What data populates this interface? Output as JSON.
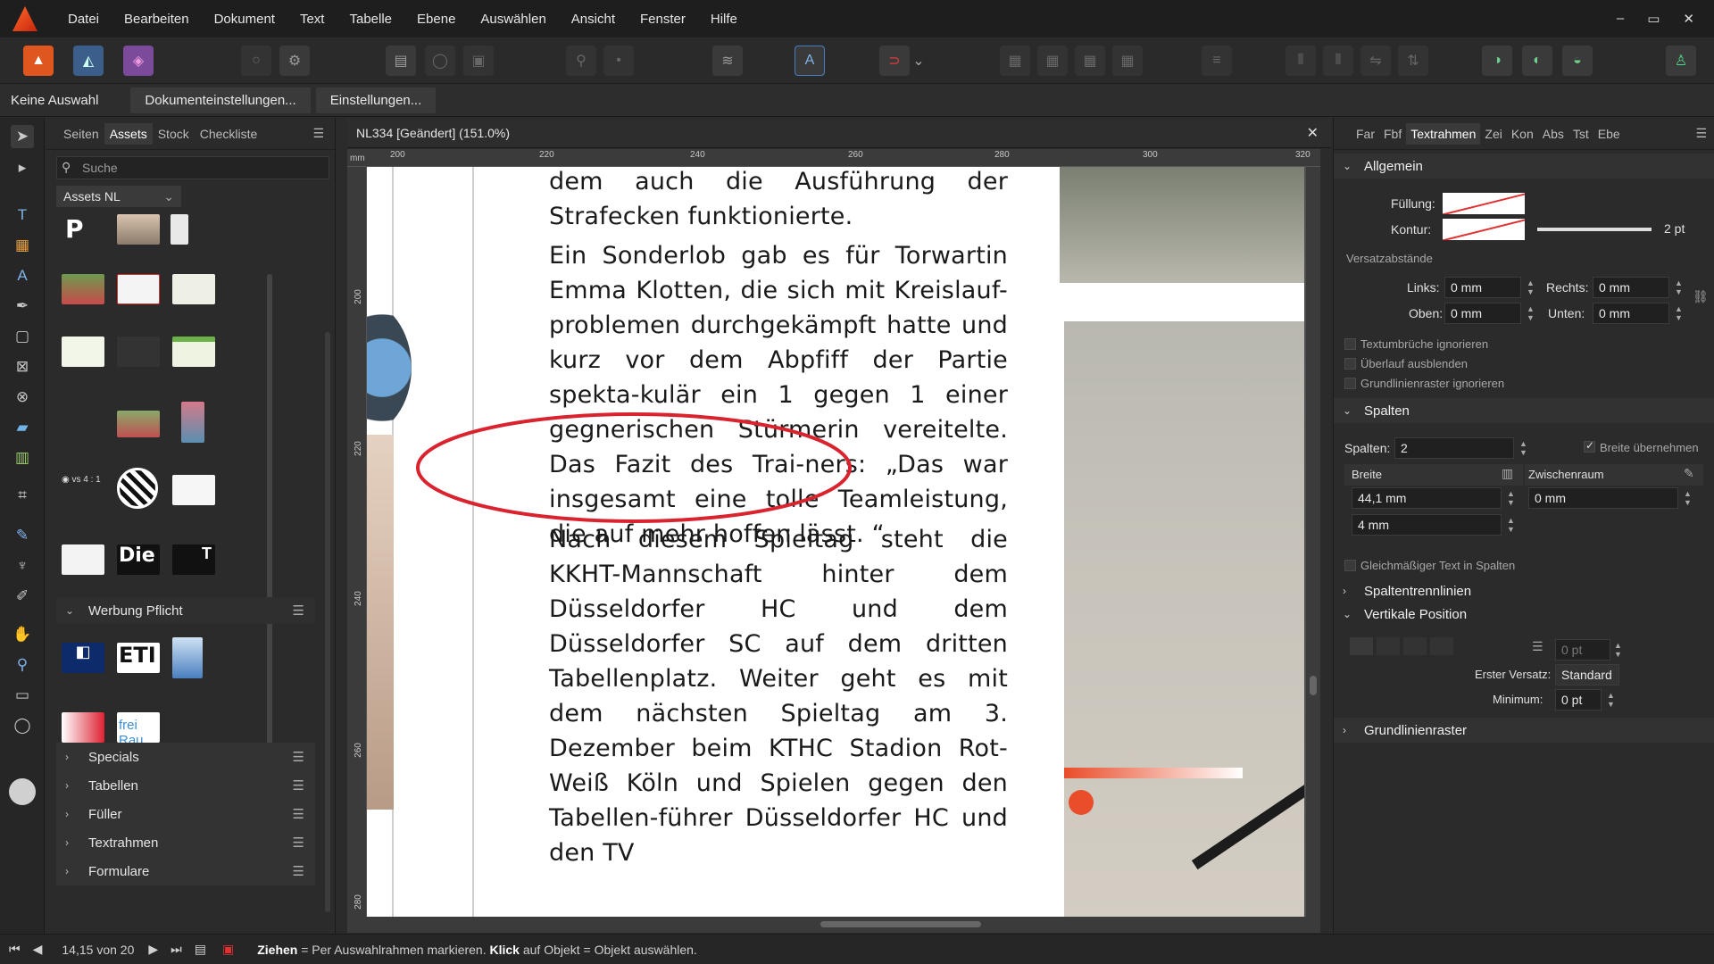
{
  "menu": [
    "Datei",
    "Bearbeiten",
    "Dokument",
    "Text",
    "Tabelle",
    "Ebene",
    "Auswählen",
    "Ansicht",
    "Fenster",
    "Hilfe"
  ],
  "window_buttons": [
    "–",
    "▭",
    "✕"
  ],
  "context": {
    "selection": "Keine Auswahl",
    "doc_settings": "Dokumenteinstellungen...",
    "settings": "Einstellungen..."
  },
  "left_panel": {
    "tabs": [
      "Seiten",
      "Assets",
      "Stock",
      "Checkliste"
    ],
    "active_tab": "Assets",
    "search_placeholder": "Suche",
    "asset_set": "Assets NL",
    "group_title": "Werbung Pflicht",
    "thumb_texts": {
      "die": "Die",
      "t": "T",
      "eti": "ETI",
      "frei": "frei Rau",
      "p": "P"
    },
    "categories": [
      "Specials",
      "Tabellen",
      "Füller",
      "Textrahmen",
      "Formulare"
    ]
  },
  "document": {
    "tab_title": "NL334 [Geändert] (151.0%)",
    "ruler_unit": "mm",
    "h_ruler": [
      "200",
      "220",
      "240",
      "260",
      "280",
      "300",
      "320"
    ],
    "v_ruler": [
      "200",
      "220",
      "240",
      "260",
      "280"
    ],
    "paragraphs": [
      "Kombinationsspiel attestierte, bei dem auch die Ausführung der Strafecken funktionierte.",
      "Ein Sonderlob gab es für Torwartin Emma Klotten, die sich mit Kreislauf-problemen durchgekämpft hatte und kurz vor dem Abpfiff der Partie spekta-kulär ein 1 gegen 1 einer gegnerischen Stürmerin vereitelte. Das Fazit des Trai-ners: „Das war insgesamt eine tolle Teamleistung, die auf mehr hoffen lässt. “",
      "Nach diesem Spieltag steht die KKHT-Mannschaft hinter dem Düsseldorfer HC und dem Düsseldorfer SC auf dem dritten Tabellenplatz. Weiter geht es mit dem nächsten Spieltag am 3. Dezember beim KTHC Stadion Rot-Weiß Köln und Spielen gegen den Tabellen-führer Düsseldorfer HC und den TV"
    ],
    "annotation_color": "#d9242f"
  },
  "right_panel": {
    "tabs": [
      "Far",
      "Fbf",
      "Textrahmen",
      "Zei",
      "Kon",
      "Abs",
      "Tst",
      "Ebe"
    ],
    "active_tab": "Textrahmen",
    "allgemein": {
      "title": "Allgemein",
      "fill_label": "Füllung:",
      "stroke_label": "Kontur:",
      "stroke_width": "2 pt",
      "insets_title": "Versatzabstände",
      "links_label": "Links:",
      "links": "0 mm",
      "rechts_label": "Rechts:",
      "rechts": "0 mm",
      "oben_label": "Oben:",
      "oben": "0 mm",
      "unten_label": "Unten:",
      "unten": "0 mm",
      "opt1": "Textumbrüche ignorieren",
      "opt2": "Überlauf ausblenden",
      "opt3": "Grundlinienraster ignorieren"
    },
    "spalten": {
      "title": "Spalten",
      "count_label": "Spalten:",
      "count": "2",
      "adopt_width": "Breite übernehmen",
      "col_width_label": "Breite",
      "gutter_label": "Zwischenraum",
      "width1": "44,1 mm",
      "gutter1": "0 mm",
      "width2": "4 mm",
      "balanced": "Gleichmäßiger Text in Spalten"
    },
    "spaltentrennlinien": "Spaltentrennlinien",
    "vertikal": {
      "title": "Vertikale Position",
      "offset": "0 pt",
      "first_label": "Erster Versatz:",
      "first": "Standard",
      "min_label": "Minimum:",
      "min": "0 pt"
    },
    "grundlinie": "Grundlinienraster"
  },
  "status": {
    "page": "14,15 von 20",
    "drag_bold": "Ziehen",
    "drag_text": " = Per Auswahlrahmen markieren. ",
    "click_bold": "Klick",
    "click_text": " auf Objekt = Objekt auswählen."
  }
}
